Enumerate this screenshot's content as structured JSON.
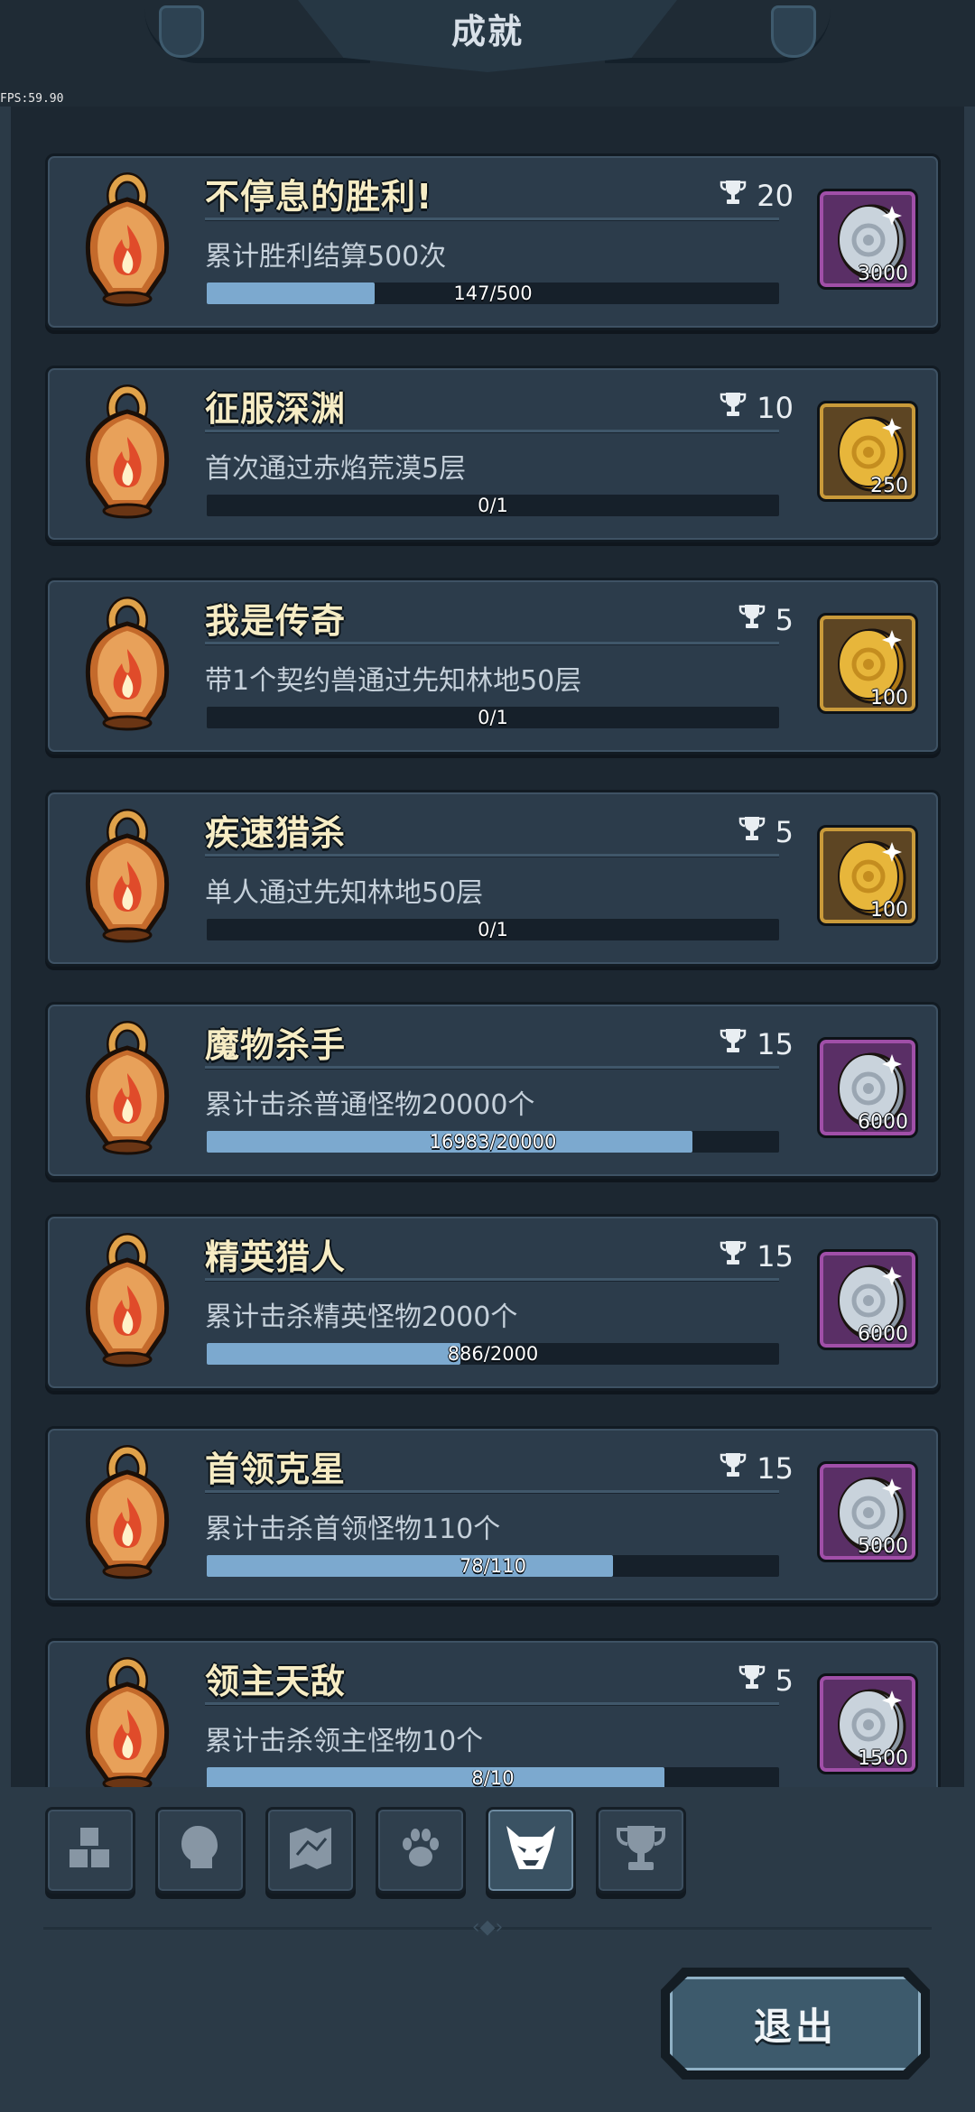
{
  "header": {
    "title": "成就",
    "fps": "FPS:59.90"
  },
  "achievements": [
    {
      "title": "不停息的胜利!",
      "points": "20",
      "desc": "累计胜利结算500次",
      "progress_text": "147/500",
      "progress": 0.294,
      "reward_type": "silver",
      "reward_qty": "3000"
    },
    {
      "title": "征服深渊",
      "points": "10",
      "desc": "首次通过赤焰荒漠5层",
      "progress_text": "0/1",
      "progress": 0,
      "reward_type": "gold",
      "reward_qty": "250"
    },
    {
      "title": "我是传奇",
      "points": "5",
      "desc": "带1个契约兽通过先知林地50层",
      "progress_text": "0/1",
      "progress": 0,
      "reward_type": "gold",
      "reward_qty": "100"
    },
    {
      "title": "疾速猎杀",
      "points": "5",
      "desc": "单人通过先知林地50层",
      "progress_text": "0/1",
      "progress": 0,
      "reward_type": "gold",
      "reward_qty": "100"
    },
    {
      "title": "魔物杀手",
      "points": "15",
      "desc": "累计击杀普通怪物20000个",
      "progress_text": "16983/20000",
      "progress": 0.849,
      "reward_type": "silver",
      "reward_qty": "6000"
    },
    {
      "title": "精英猎人",
      "points": "15",
      "desc": "累计击杀精英怪物2000个",
      "progress_text": "886/2000",
      "progress": 0.443,
      "reward_type": "silver",
      "reward_qty": "6000"
    },
    {
      "title": "首领克星",
      "points": "15",
      "desc": "累计击杀首领怪物110个",
      "progress_text": "78/110",
      "progress": 0.709,
      "reward_type": "silver",
      "reward_qty": "5000"
    },
    {
      "title": "领主天敌",
      "points": "5",
      "desc": "累计击杀领主怪物10个",
      "progress_text": "8/10",
      "progress": 0.8,
      "reward_type": "silver",
      "reward_qty": "1500"
    }
  ],
  "tabs": [
    {
      "name": "tab-items",
      "icon": "blocks-icon",
      "active": false
    },
    {
      "name": "tab-heroes",
      "icon": "head-profile-icon",
      "active": false
    },
    {
      "name": "tab-map",
      "icon": "map-scroll-icon",
      "active": false
    },
    {
      "name": "tab-pets",
      "icon": "paw-icon",
      "active": false
    },
    {
      "name": "tab-monsters",
      "icon": "demon-mask-icon",
      "active": true
    },
    {
      "name": "tab-achievements",
      "icon": "trophy-icon",
      "active": false
    }
  ],
  "exit_label": "退出",
  "colors": {
    "silver_frame": "#a04fa8",
    "silver_bg": "#5a2f66",
    "gold_frame": "#c99a3a",
    "gold_bg": "#5d4523",
    "progress_fill": "#7ca9cf"
  }
}
